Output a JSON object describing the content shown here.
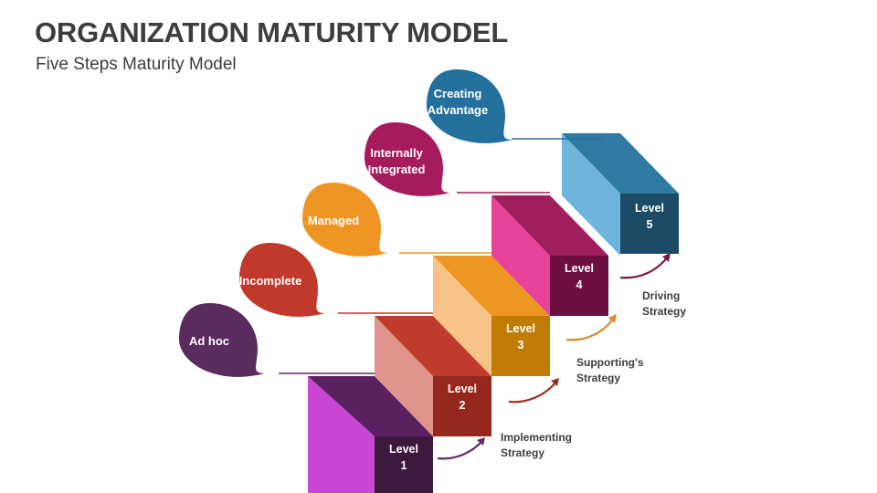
{
  "header": {
    "title": "ORGANIZATION MATURITY MODEL",
    "subtitle": "Five Steps Maturity Model"
  },
  "chart_data": {
    "type": "diagram",
    "title": "ORGANIZATION MATURITY MODEL",
    "subtitle": "Five Steps Maturity Model",
    "levels": [
      {
        "id": 1,
        "label_line1": "Level",
        "label_line2": "1",
        "stage": "Ad hoc",
        "front": "#3D1A3D",
        "top": "#5B2060",
        "side": "#C945D4"
      },
      {
        "id": 2,
        "label_line1": "Level",
        "label_line2": "2",
        "stage": "Incomplete",
        "front": "#96271C",
        "top": "#C13B2C",
        "side": "#E0948B"
      },
      {
        "id": 3,
        "label_line1": "Level",
        "label_line2": "3",
        "stage": "Managed",
        "front": "#C07C05",
        "top": "#EF9523",
        "side": "#F8C387"
      },
      {
        "id": 4,
        "label_line1": "Level",
        "label_line2": "4",
        "stage": "Internally Integrated",
        "front": "#6B1040",
        "top": "#A01E5C",
        "side": "#E8439A"
      },
      {
        "id": 5,
        "label_line1": "Level",
        "label_line2": "5",
        "stage": "Creating Advantage",
        "front": "#1B4B66",
        "top": "#2E7AA3",
        "side": "#6FB4DC"
      }
    ],
    "callouts": [
      {
        "id": "ad-hoc",
        "text_line1": "Ad hoc",
        "text_line2": "",
        "color": "#5B2A5E"
      },
      {
        "id": "incomplete",
        "text_line1": "Incomplete",
        "text_line2": "",
        "color": "#C0392B"
      },
      {
        "id": "managed",
        "text_line1": "Managed",
        "text_line2": "",
        "color": "#EF9523"
      },
      {
        "id": "internally-integrated",
        "text_line1": "Internally",
        "text_line2": "Integrated",
        "color": "#A61B5C"
      },
      {
        "id": "creating-advantage",
        "text_line1": "Creating",
        "text_line2": "Advantage",
        "color": "#22709B"
      }
    ],
    "strategies": [
      {
        "id": "implementing",
        "line1": "Implementing",
        "line2": "Strategy",
        "arrow_color": "#5B2A5E"
      },
      {
        "id": "supportings",
        "line1": "Supporting's",
        "line2": "Strategy",
        "arrow_color": "#D9892A"
      },
      {
        "id": "driving",
        "line1": "Driving",
        "line2": "Strategy",
        "arrow_color": "#7A1744"
      }
    ],
    "arrow_level2": {
      "color": "#9C2B1E"
    },
    "background": "#FFFFFF",
    "text_color": "#3D3D3D"
  }
}
